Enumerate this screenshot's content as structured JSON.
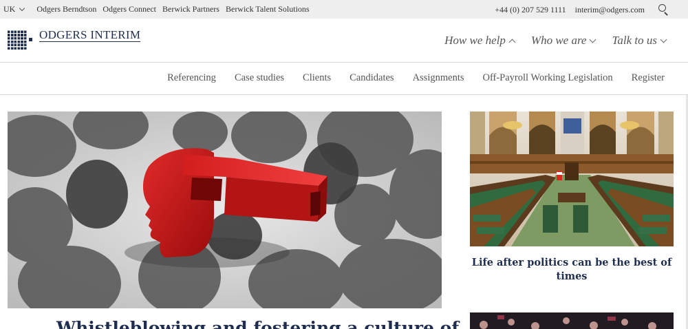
{
  "utility": {
    "country": "UK",
    "sites": [
      "Odgers Berndtson",
      "Odgers Connect",
      "Berwick Partners",
      "Berwick Talent Solutions"
    ],
    "phone": "+44 (0) 207 529 1111",
    "email": "interim@odgers.com"
  },
  "brand": {
    "name": "ODGERS INTERIM",
    "color": "#1f2e4f"
  },
  "main_nav": [
    {
      "label": "How we help",
      "state": "expanded"
    },
    {
      "label": "Who we are",
      "state": "collapsed"
    },
    {
      "label": "Talk to us",
      "state": "collapsed"
    }
  ],
  "sub_nav": [
    "Referencing",
    "Case studies",
    "Clients",
    "Candidates",
    "Assignments",
    "Off-Payroll Working Legislation",
    "Register"
  ],
  "feature": {
    "title": "Whistleblowing and fostering a culture of",
    "image": "red-whistle-illustration"
  },
  "sidebar_cards": [
    {
      "title": "Life after politics can be the best of times",
      "image": "parliament-chamber-photo"
    },
    {
      "title": "",
      "image": "crowd-photo"
    }
  ],
  "icons": {
    "search": "search-icon",
    "country_chevron": "chevron-down-icon"
  }
}
